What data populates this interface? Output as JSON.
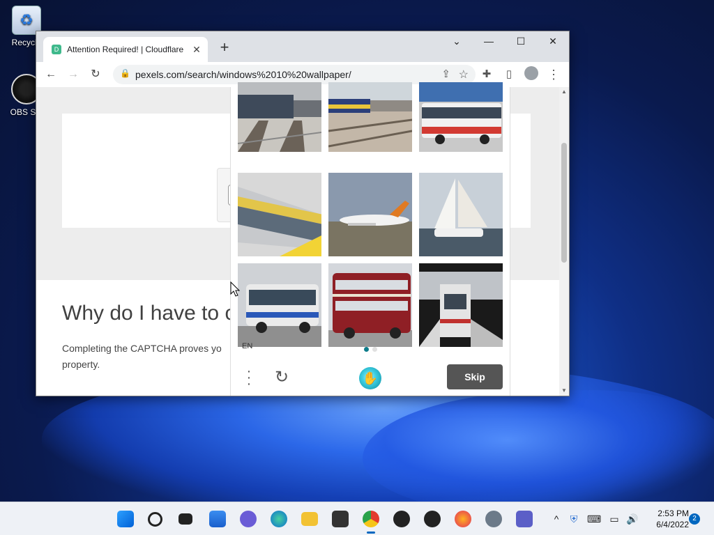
{
  "desktop": {
    "icons": [
      {
        "label": "Recycle"
      },
      {
        "label": "OBS Stu"
      }
    ]
  },
  "browser": {
    "tab_title": "Attention Required! | Cloudflare",
    "favicon_letter": "D",
    "url": "pexels.com/search/windows%2010%20wallpaper/",
    "controls": {
      "minimize": "—",
      "maximize": "☐",
      "close": "✕",
      "dropdown": "⌄"
    }
  },
  "page": {
    "heading": "Why do I have to c",
    "body_text": "Completing the CAPTCHA proves yo property."
  },
  "captcha": {
    "language": "EN",
    "skip_label": "Skip",
    "tiles": [
      {
        "name": "train-tracks-tile"
      },
      {
        "name": "train-station-tile"
      },
      {
        "name": "red-white-bus-tile"
      },
      {
        "name": "yellow-train-tile"
      },
      {
        "name": "airplane-tile"
      },
      {
        "name": "sailboat-tile"
      },
      {
        "name": "blue-bus-tile"
      },
      {
        "name": "double-decker-bus-tile"
      },
      {
        "name": "train-platform-tile"
      }
    ]
  },
  "taskbar": {
    "time": "2:53 PM",
    "date": "6/4/2022",
    "notification_count": "2"
  }
}
